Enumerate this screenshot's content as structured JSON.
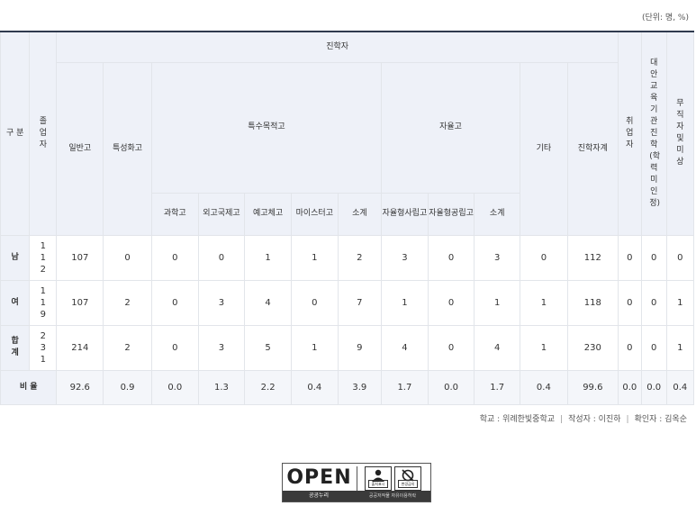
{
  "unit_note": "(단위: 명, %)",
  "headers": {
    "gubun": "구 분",
    "graduates": "졸업자",
    "jinhakja": "진학자",
    "general": "일반고",
    "specialized": "특성화고",
    "special_purpose": "특수목적고",
    "science": "과학고",
    "foreign": "외고국제고",
    "arts": "예고체고",
    "meister": "마이스터고",
    "subtotal": "소계",
    "autonomous": "자율고",
    "auto_private": "자율형사립고",
    "auto_public": "자율형공립고",
    "auto_subtotal": "소계",
    "other": "기타",
    "advance_total": "진학자계",
    "employed": "취업자",
    "alt_edu": "대안교육기관진학(학력미인정)",
    "unemployed": "무직자및미상"
  },
  "rows": [
    {
      "label": "남",
      "values": [
        "112",
        "107",
        "0",
        "0",
        "0",
        "1",
        "1",
        "2",
        "3",
        "0",
        "3",
        "0",
        "112",
        "0",
        "0",
        "0"
      ]
    },
    {
      "label": "여",
      "values": [
        "119",
        "107",
        "2",
        "0",
        "3",
        "4",
        "0",
        "7",
        "1",
        "0",
        "1",
        "1",
        "118",
        "0",
        "0",
        "1"
      ]
    },
    {
      "label": "합계",
      "values": [
        "231",
        "214",
        "2",
        "0",
        "3",
        "5",
        "1",
        "9",
        "4",
        "0",
        "4",
        "1",
        "230",
        "0",
        "0",
        "1"
      ]
    }
  ],
  "ratio": {
    "label": "비 율",
    "values": [
      "92.6",
      "0.9",
      "0.0",
      "1.3",
      "2.2",
      "0.4",
      "3.9",
      "1.7",
      "0.0",
      "1.7",
      "0.4",
      "99.6",
      "0.0",
      "0.0",
      "0.4"
    ]
  },
  "footer": {
    "school": "학교 : 위례한빛중학교",
    "author": "작성자 : 이진하",
    "checker": "확인자 : 김옥순",
    "separator": "|"
  },
  "license": {
    "open_word": "OPEN",
    "nuri": "공공누리",
    "desc": "공공저작물 자유이용허락",
    "tag1": "출처표시",
    "tag2": "변경금지"
  }
}
